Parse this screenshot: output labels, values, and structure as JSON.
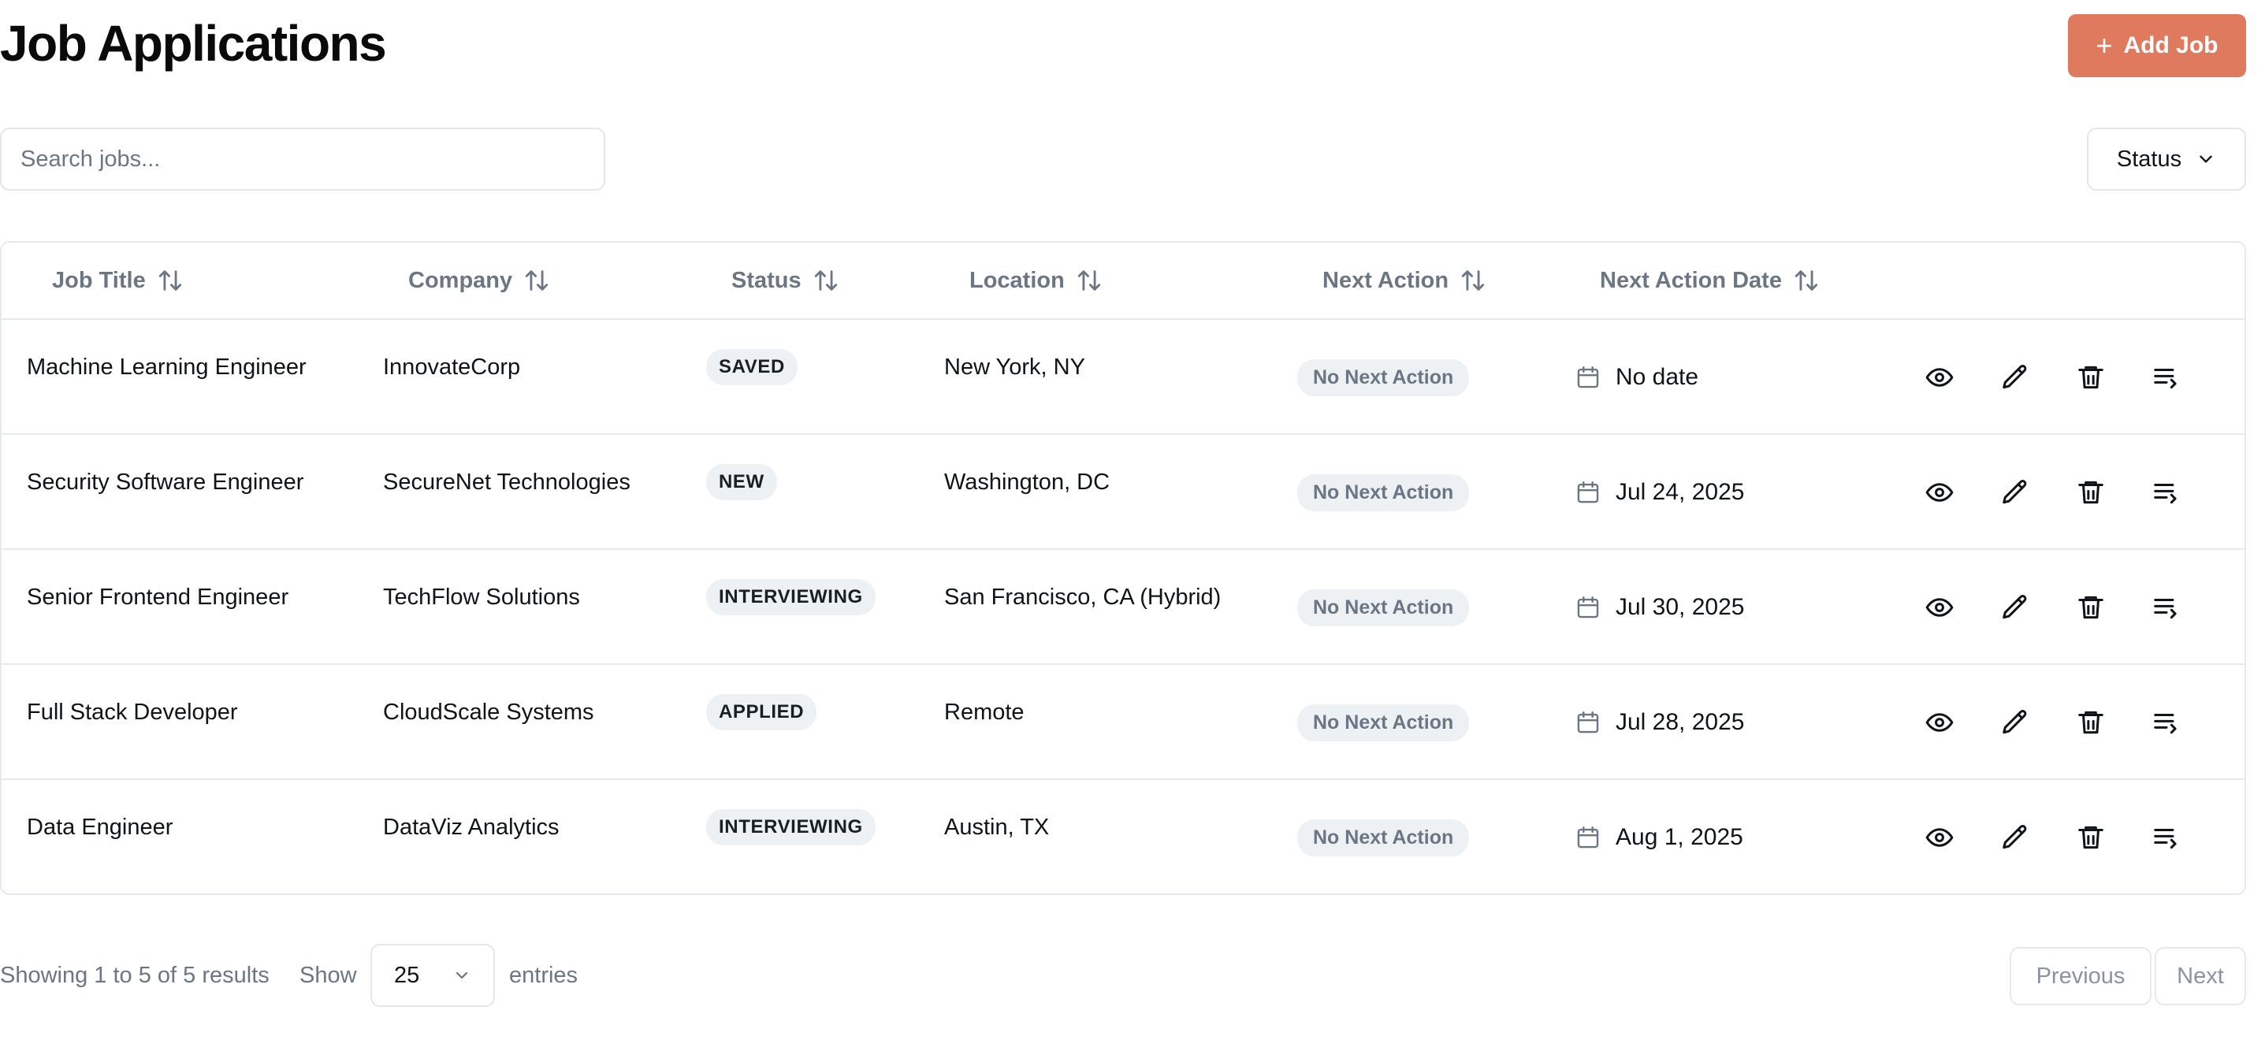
{
  "header": {
    "title": "Job Applications",
    "add_button_label": "Add Job",
    "add_button_color": "#e07a5f"
  },
  "filters": {
    "search_placeholder": "Search jobs...",
    "search_value": "",
    "status_label": "Status"
  },
  "table": {
    "columns": [
      "Job Title",
      "Company",
      "Status",
      "Location",
      "Next Action",
      "Next Action Date"
    ],
    "rows": [
      {
        "title": "Machine Learning Engineer",
        "company": "InnovateCorp",
        "status": "SAVED",
        "location": "New York, NY",
        "next_action": "No Next Action",
        "next_action_date": "No date"
      },
      {
        "title": "Security Software Engineer",
        "company": "SecureNet Technologies",
        "status": "NEW",
        "location": "Washington, DC",
        "next_action": "No Next Action",
        "next_action_date": "Jul 24, 2025"
      },
      {
        "title": "Senior Frontend Engineer",
        "company": "TechFlow Solutions",
        "status": "INTERVIEWING",
        "location": "San Francisco, CA (Hybrid)",
        "next_action": "No Next Action",
        "next_action_date": "Jul 30, 2025"
      },
      {
        "title": "Full Stack Developer",
        "company": "CloudScale Systems",
        "status": "APPLIED",
        "location": "Remote",
        "next_action": "No Next Action",
        "next_action_date": "Jul 28, 2025"
      },
      {
        "title": "Data Engineer",
        "company": "DataViz Analytics",
        "status": "INTERVIEWING",
        "location": "Austin, TX",
        "next_action": "No Next Action",
        "next_action_date": "Aug 1, 2025"
      }
    ],
    "row_actions": [
      "eye-icon",
      "pencil-icon",
      "trash-icon",
      "list-add-icon"
    ]
  },
  "footer": {
    "showing_text": "Showing 1 to 5 of 5 results",
    "show_label": "Show",
    "page_size": "25",
    "entries_label": "entries",
    "previous_label": "Previous",
    "next_label": "Next"
  }
}
